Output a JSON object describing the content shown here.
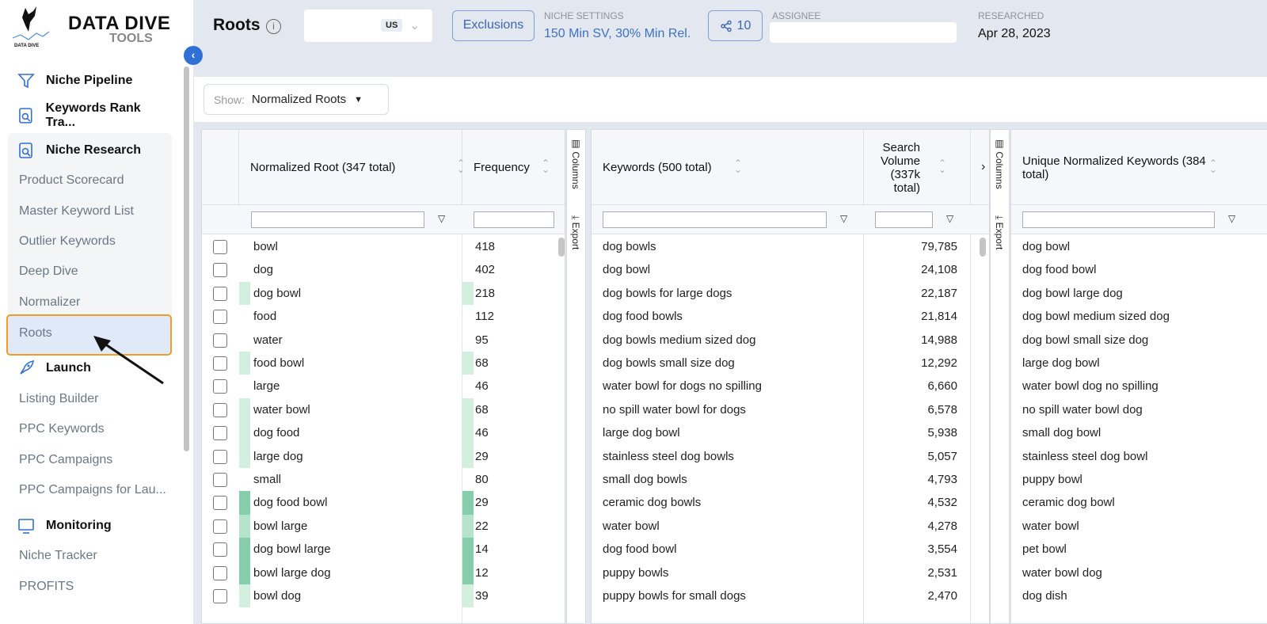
{
  "brand": {
    "name": "DATA DIVE",
    "sub": "TOOLS",
    "mark_text": "DATA DIVE TOOLS"
  },
  "sidebar": {
    "groups": [
      {
        "label": "Niche Pipeline",
        "icon": "funnel-icon"
      },
      {
        "label": "Keywords Rank Tra...",
        "icon": "search-doc-icon"
      },
      {
        "label": "Niche Research",
        "icon": "search-doc-icon"
      },
      {
        "label": "Launch",
        "icon": "rocket-icon"
      },
      {
        "label": "Monitoring",
        "icon": "monitor-icon"
      }
    ],
    "research_items": [
      "Product Scorecard",
      "Master Keyword List",
      "Outlier Keywords",
      "Deep Dive",
      "Normalizer",
      "Roots"
    ],
    "launch_items": [
      "Listing Builder",
      "PPC Keywords",
      "PPC Campaigns",
      "PPC Campaigns for Lau..."
    ],
    "monitoring_items": [
      "Niche Tracker",
      "PROFITS"
    ],
    "active": "Roots",
    "highlight_color": "#f29b26"
  },
  "header": {
    "title": "Roots",
    "marketplace": "US",
    "exclusions": "Exclusions",
    "niche_settings_label": "NICHE SETTINGS",
    "niche_settings_value": "150 Min SV, 30% Min Rel.",
    "share_count": "10",
    "assignee_label": "ASSIGNEE",
    "assignee_value": "",
    "researched_label": "RESEARCHED",
    "researched_value": "Apr 28, 2023"
  },
  "toolbar": {
    "show_label": "Show:",
    "show_value": "Normalized Roots"
  },
  "side_panel": {
    "columns": "Columns",
    "export": "Export"
  },
  "roots_table": {
    "headers": [
      "Normalized Root (347 total)",
      "Frequency"
    ],
    "rows": [
      [
        "bowl",
        "418",
        0
      ],
      [
        "dog",
        "402",
        0
      ],
      [
        "dog bowl",
        "218",
        1
      ],
      [
        "food",
        "112",
        0
      ],
      [
        "water",
        "95",
        0
      ],
      [
        "food bowl",
        "68",
        1
      ],
      [
        "large",
        "46",
        0
      ],
      [
        "water bowl",
        "68",
        1
      ],
      [
        "dog food",
        "46",
        1
      ],
      [
        "large dog",
        "29",
        1
      ],
      [
        "small",
        "80",
        0
      ],
      [
        "dog food bowl",
        "29",
        3
      ],
      [
        "bowl large",
        "22",
        2
      ],
      [
        "dog bowl large",
        "14",
        3
      ],
      [
        "bowl large dog",
        "12",
        3
      ],
      [
        "bowl dog",
        "39",
        1
      ]
    ]
  },
  "keywords_table": {
    "headers": [
      "Keywords (500 total)",
      "Search Volume (337k total)"
    ],
    "rows": [
      [
        "dog bowls",
        "79,785"
      ],
      [
        "dog bowl",
        "24,108"
      ],
      [
        "dog bowls for large dogs",
        "22,187"
      ],
      [
        "dog food bowls",
        "21,814"
      ],
      [
        "dog bowls medium sized dog",
        "14,988"
      ],
      [
        "dog bowls small size dog",
        "12,292"
      ],
      [
        "water bowl for dogs no spilling",
        "6,660"
      ],
      [
        "no spill water bowl for dogs",
        "6,578"
      ],
      [
        "large dog bowl",
        "5,938"
      ],
      [
        "stainless steel dog bowls",
        "5,057"
      ],
      [
        "small dog bowls",
        "4,793"
      ],
      [
        "ceramic dog bowls",
        "4,532"
      ],
      [
        "water bowl",
        "4,278"
      ],
      [
        "dog food bowl",
        "3,554"
      ],
      [
        "puppy bowls",
        "2,531"
      ],
      [
        "puppy bowls for small dogs",
        "2,470"
      ]
    ]
  },
  "unique_table": {
    "headers": [
      "Unique Normalized Keywords (384 total)"
    ],
    "rows": [
      "dog bowl",
      "dog food bowl",
      "dog bowl large dog",
      "dog bowl medium sized dog",
      "dog bowl small size dog",
      "large dog bowl",
      "water bowl dog no spilling",
      "no spill water bowl dog",
      "small dog bowl",
      "stainless steel dog bowl",
      "puppy bowl",
      "ceramic dog bowl",
      "water bowl",
      "pet bowl",
      "water bowl dog",
      "dog dish"
    ]
  },
  "colors": {
    "accent": "#2f6fd6",
    "header_bg": "#e3e8f0",
    "heat": [
      "#ffffff",
      "#d3efe0",
      "#b5e3cb",
      "#86ceab"
    ]
  }
}
